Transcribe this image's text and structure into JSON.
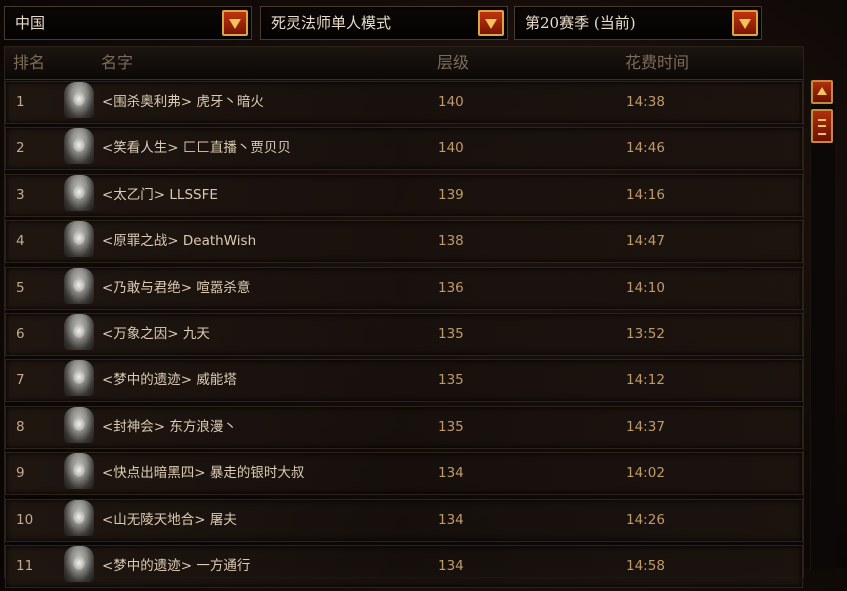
{
  "filters": {
    "region": "中国",
    "class_mode": "死灵法师单人模式",
    "season": "第20赛季 (当前)"
  },
  "columns": {
    "rank": "排名",
    "name": "名字",
    "level": "层级",
    "time": "花费时间"
  },
  "rows": [
    {
      "rank": "1",
      "name": "<围杀奥利弗> 虎牙丶暗火",
      "level": "140",
      "time": "14:38"
    },
    {
      "rank": "2",
      "name": "<笑看人生> 匚匚直播丶贾贝贝",
      "level": "140",
      "time": "14:46"
    },
    {
      "rank": "3",
      "name": "<太乙门> LLSSFE",
      "level": "139",
      "time": "14:16"
    },
    {
      "rank": "4",
      "name": "<原罪之战> DeathWish",
      "level": "138",
      "time": "14:47"
    },
    {
      "rank": "5",
      "name": "<乃敢与君绝> 喧嚣杀意",
      "level": "136",
      "time": "14:10"
    },
    {
      "rank": "6",
      "name": "<万象之因> 九天",
      "level": "135",
      "time": "13:52"
    },
    {
      "rank": "7",
      "name": "<梦中的遗迹> 威能塔",
      "level": "135",
      "time": "14:12"
    },
    {
      "rank": "8",
      "name": "<封神会> 东方浪漫丶",
      "level": "135",
      "time": "14:37"
    },
    {
      "rank": "9",
      "name": "<快点出暗黑四> 暴走的银时大叔",
      "level": "134",
      "time": "14:02"
    },
    {
      "rank": "10",
      "name": "<山无陵天地合> 屠夫",
      "level": "134",
      "time": "14:26"
    },
    {
      "rank": "11",
      "name": "<梦中的遗迹> 一方通行",
      "level": "134",
      "time": "14:58"
    }
  ],
  "icons": {
    "dropdown": "chevron-down-icon",
    "scroll_up": "arrow-up-icon",
    "scroll_thumb": "grip-icon",
    "avatar": "necromancer-portrait"
  },
  "colors": {
    "accent": "#b02f0d",
    "gold": "#f3c25a",
    "header_text": "#7d6b58",
    "value_text": "#c09a6a"
  }
}
